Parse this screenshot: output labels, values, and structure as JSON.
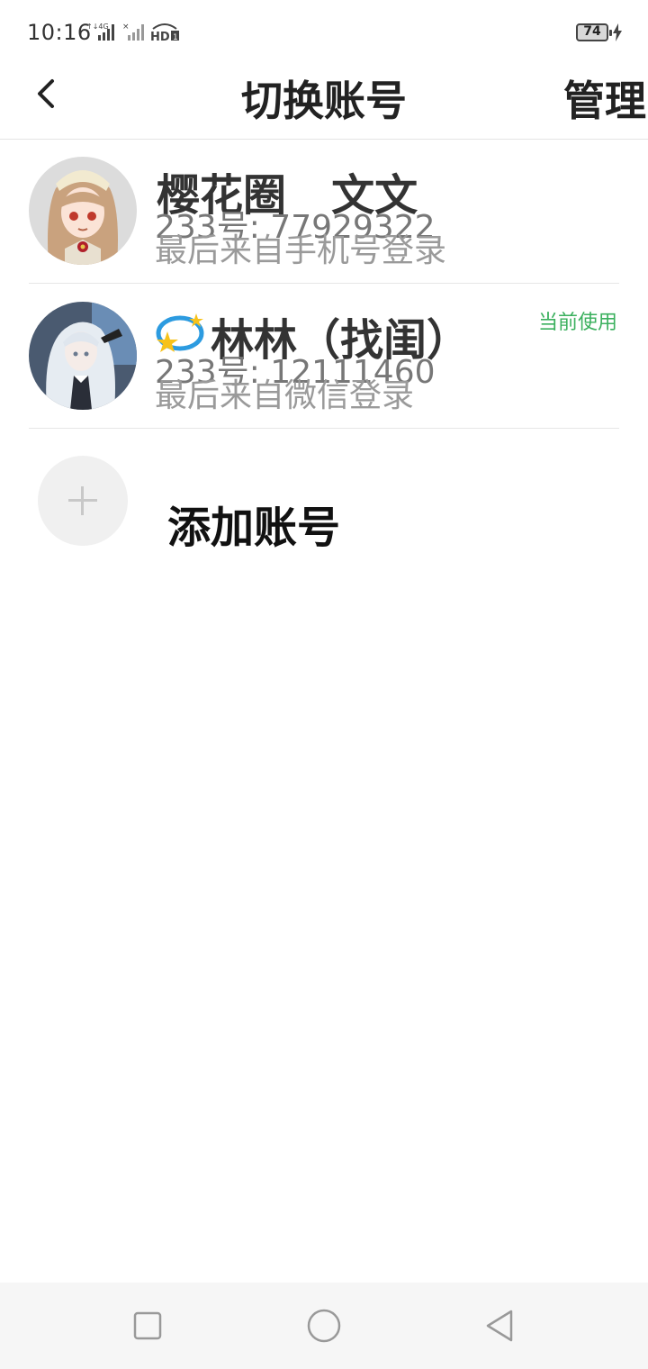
{
  "status_bar": {
    "time": "10:16",
    "battery_level": "74",
    "icons": [
      "signal-4g-icon",
      "signal-icon",
      "hd-icon",
      "battery-icon",
      "charging-icon"
    ]
  },
  "header": {
    "title": "切换账号",
    "manage_label": "管理",
    "back_icon": "chevron-left-icon"
  },
  "accounts": [
    {
      "name": "樱花圈   文文",
      "uid": "233号: 77929322",
      "login_method": "最后来自手机号登录",
      "is_current": false
    },
    {
      "name": "林林（找闺）",
      "uid": "233号: 12111460",
      "login_method": "最后来自微信登录",
      "is_current": true,
      "current_label": "当前使用",
      "badge_icon": "qq-star-icon"
    }
  ],
  "add_account": {
    "label": "添加账号",
    "icon": "plus-icon"
  },
  "nav_bar": {
    "buttons": [
      "recent-apps-icon",
      "home-icon",
      "back-triangle-icon"
    ]
  },
  "colors": {
    "accent_green": "#3bb05e",
    "text_dark": "#222222",
    "text_gray": "#9a9a9a",
    "nav_bg": "#f6f6f6"
  }
}
